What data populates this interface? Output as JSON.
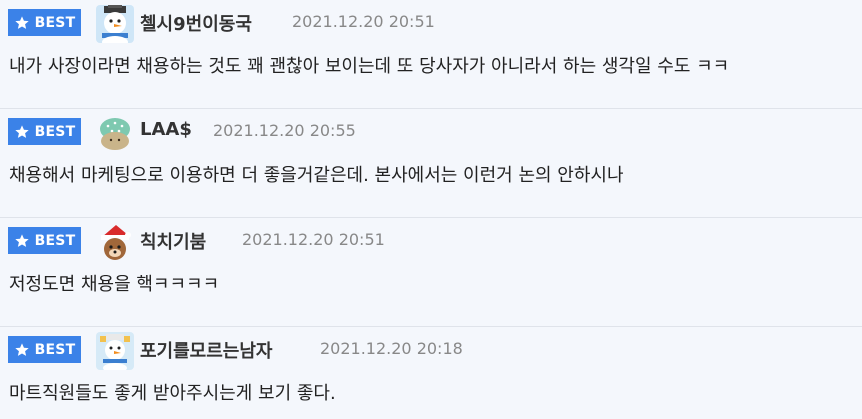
{
  "comments": [
    {
      "badge": "BEST",
      "avatar_icon": "snowman-avatar-icon",
      "nickname": "첼시9번이동국",
      "timestamp": "2021.12.20 20:51",
      "content": "내가 사장이라면 채용하는 것도 꽤 괜찮아 보이는데 또 당사자가 아니라서 하는 생각일 수도 ㅋㅋ"
    },
    {
      "badge": "BEST",
      "avatar_icon": "cupcake-avatar-icon",
      "nickname": "LAA$",
      "timestamp": "2021.12.20 20:55",
      "content": "채용해서 마케팅으로 이용하면 더 좋을거같은데. 본사에서는 이런거 논의 안하시나"
    },
    {
      "badge": "BEST",
      "avatar_icon": "santa-bear-avatar-icon",
      "nickname": "칙치기붐",
      "timestamp": "2021.12.20 20:51",
      "content": "저정도면 채용을 핵ㅋㅋㅋㅋ"
    },
    {
      "badge": "BEST",
      "avatar_icon": "snowman-avatar-icon",
      "nickname": "포기를모르는남자",
      "timestamp": "2021.12.20 20:18",
      "content": "마트직원들도 좋게 받아주시는게 보기 좋다."
    }
  ],
  "colors": {
    "badge_bg": "#3b82e8",
    "background": "#f4f7fc",
    "timestamp": "#888888"
  }
}
